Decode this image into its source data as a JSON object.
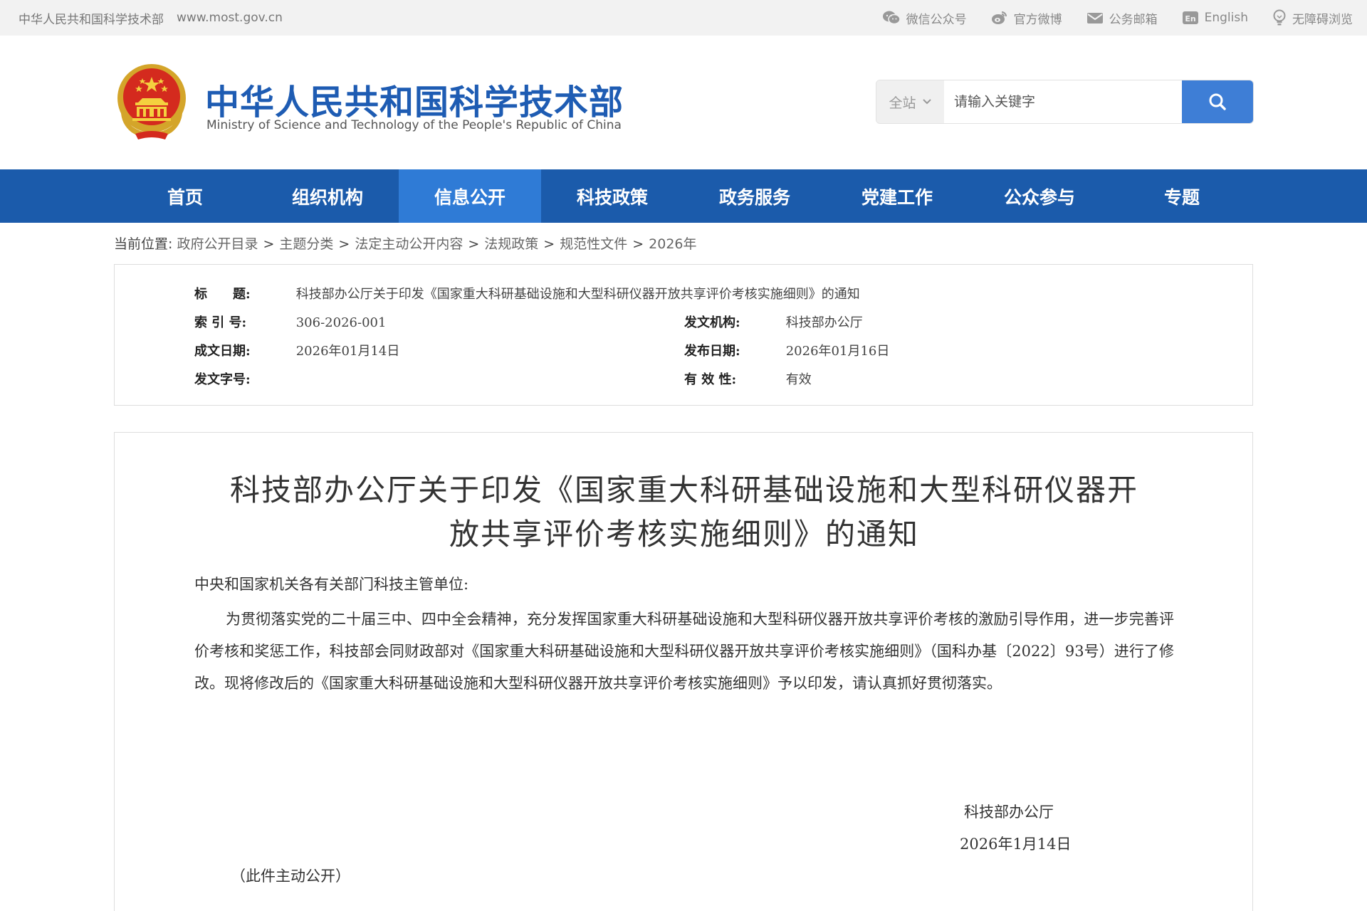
{
  "topbar": {
    "site_name": "中华人民共和国科学技术部",
    "url": "www.most.gov.cn",
    "links": [
      "微信公众号",
      "官方微博",
      "公务邮箱",
      "English",
      "无障碍浏览"
    ]
  },
  "header": {
    "title": "中华人民共和国科学技术部",
    "subtitle": "Ministry of Science and Technology of the People's Republic of China",
    "search_scope": "全站",
    "search_placeholder": "请输入关键字"
  },
  "nav": {
    "items": [
      "首页",
      "组织机构",
      "信息公开",
      "科技政策",
      "政务服务",
      "党建工作",
      "公众参与",
      "专题"
    ],
    "active": "信息公开"
  },
  "breadcrumb": {
    "label": "当前位置:",
    "items": [
      "政府公开目录",
      "主题分类",
      "法定主动公开内容",
      "法规政策",
      "规范性文件",
      "2026年"
    ],
    "separator": ">"
  },
  "meta": {
    "title_label": "标　　题:",
    "title_value": "科技部办公厅关于印发《国家重大科研基础设施和大型科研仪器开放共享评价考核实施细则》的通知",
    "index_label": "索 引 号:",
    "index_value": "306-2026-001",
    "issuer_label": "发文机构:",
    "issuer_value": "科技部办公厅",
    "created_label": "成文日期:",
    "created_value": "2026年01月14日",
    "published_label": "发布日期:",
    "published_value": "2026年01月16日",
    "docno_label": "发文字号:",
    "docno_value": "",
    "validity_label": "有 效 性:",
    "validity_value": "有效"
  },
  "article": {
    "title_line1": "科技部办公厅关于印发《国家重大科研基础设施和大型科研仪器开",
    "title_line2": "放共享评价考核实施细则》的通知",
    "salutation": "中央和国家机关各有关部门科技主管单位:",
    "body": "为贯彻落实党的二十届三中、四中全会精神，充分发挥国家重大科研基础设施和大型科研仪器开放共享评价考核的激励引导作用，进一步完善评价考核和奖惩工作，科技部会同财政部对《国家重大科研基础设施和大型科研仪器开放共享评价考核实施细则》（国科办基〔2022〕93号）进行了修改。现将修改后的《国家重大科研基础设施和大型科研仪器开放共享评价考核实施细则》予以印发，请认真抓好贯彻落实。",
    "signature": "科技部办公厅",
    "date": "2026年1月14日",
    "note": "（此件主动公开）"
  },
  "colors": {
    "nav_bg": "#1b5bab",
    "nav_active": "#2f7bd6",
    "title_blue": "#1e5cb3",
    "search_btn": "#3e7ed6"
  }
}
